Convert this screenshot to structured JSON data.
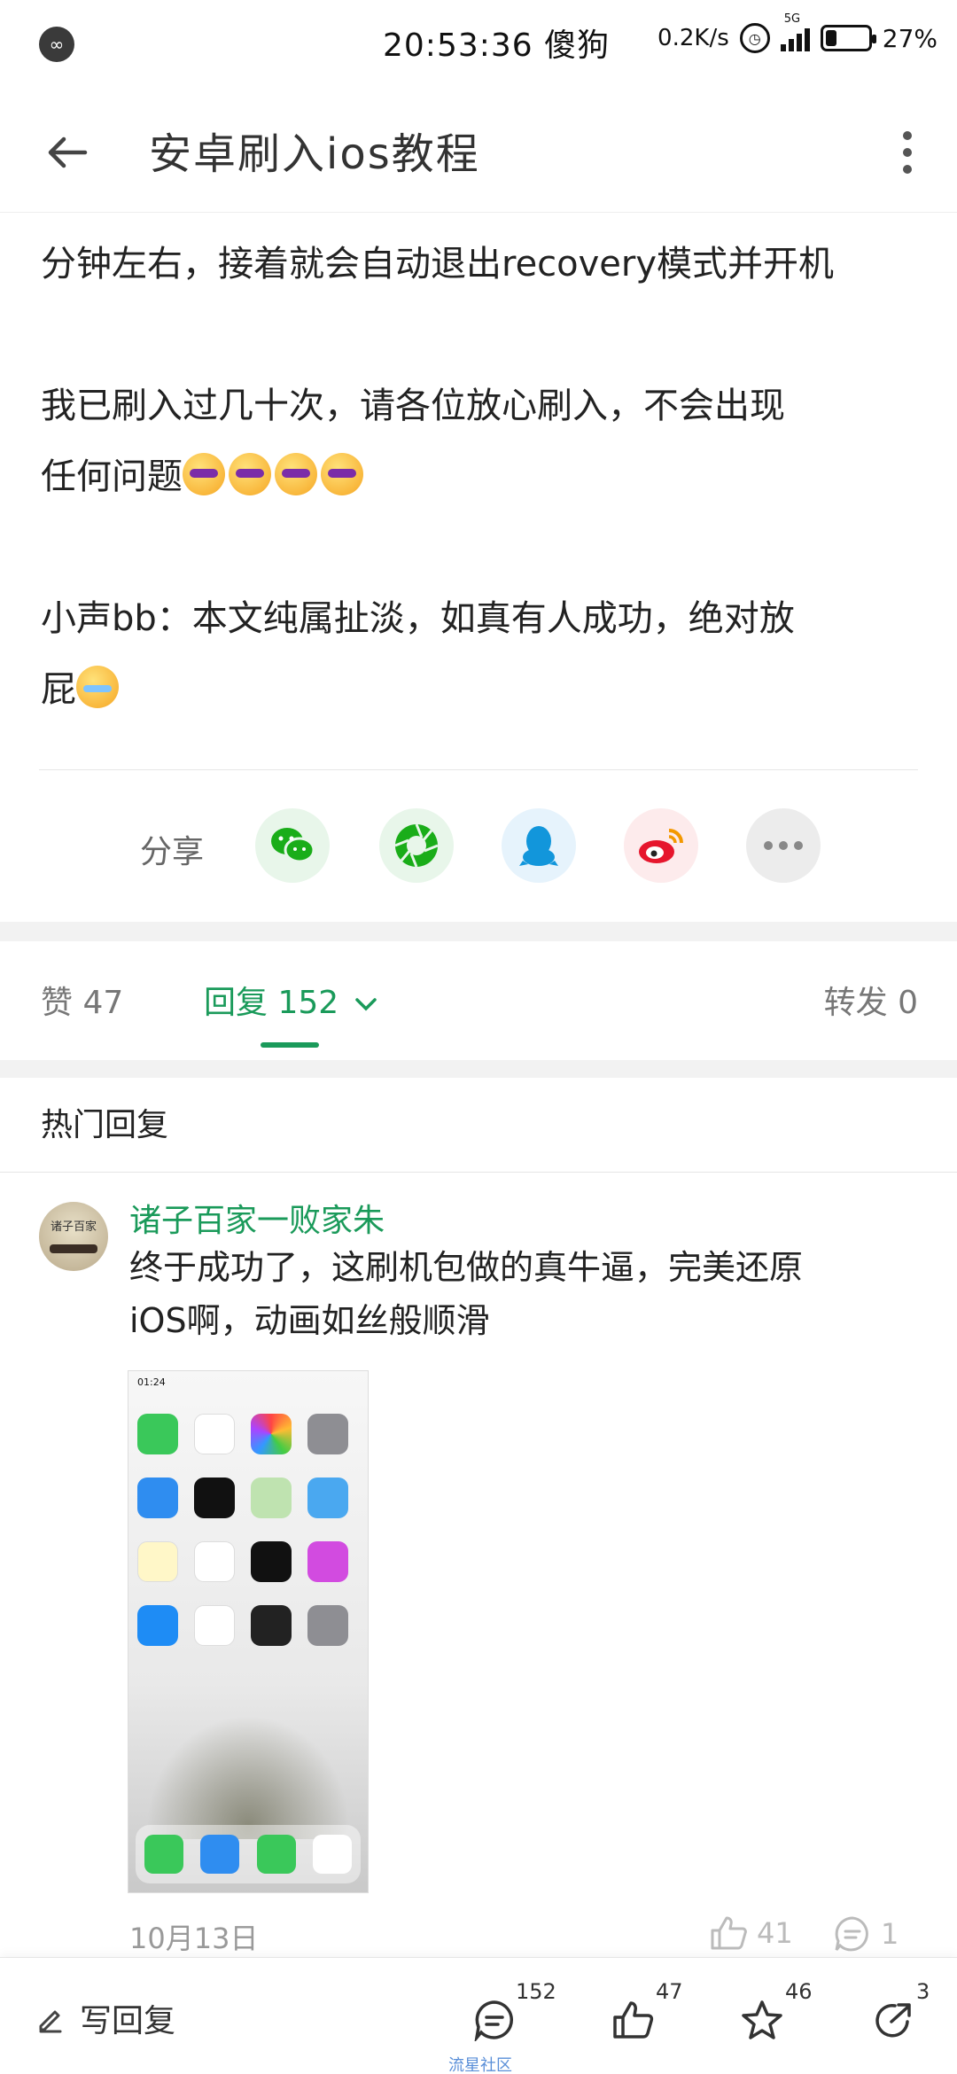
{
  "status_bar": {
    "time": "20:53:36",
    "carrier": "傻狗",
    "net_speed": "0.2K/s",
    "network_type": "5G",
    "battery": "27%",
    "battery_level": 0.27
  },
  "app_bar": {
    "title": "安卓刷入ios教程"
  },
  "article": {
    "line1": "分钟左右，接着就会自动退出recovery模式并开机",
    "para2_line1": "我已刷入过几十次，请各位放心刷入，不会出现",
    "para2_line2": "任何问题",
    "para3_line1": "小声bb：本文纯属扯淡，如真有人成功，绝对放",
    "para3_line2": "屁"
  },
  "share": {
    "label": "分享",
    "icons": [
      "wechat-icon",
      "moments-icon",
      "qq-icon",
      "weibo-icon",
      "more-icon"
    ],
    "colors": {
      "wechat": "#1aad19",
      "moments": "#1aad19",
      "qq": "#1296db",
      "weibo": "#e6162d",
      "more": "#888888"
    }
  },
  "tabs": {
    "like_label": "赞 47",
    "reply_label": "回复 152",
    "forward_label": "转发 0"
  },
  "hot_replies": {
    "title": "热门回复",
    "comments": [
      {
        "user": "诸子百家一败家朱",
        "text_line1": "终于成功了，这刷机包做的真牛逼，完美还原",
        "text_line2": "iOS啊，动画如丝般顺滑",
        "date": "10月13日",
        "likes": "41",
        "replies": "1",
        "image_time": "01:24"
      }
    ]
  },
  "bottom_bar": {
    "write_reply": "写回复",
    "comment_count": "152",
    "like_count": "47",
    "star_count": "46",
    "share_count": "3",
    "watermark": "流星社区"
  },
  "colors": {
    "accent": "#1a9a5a",
    "band": "#f2f2f2"
  }
}
